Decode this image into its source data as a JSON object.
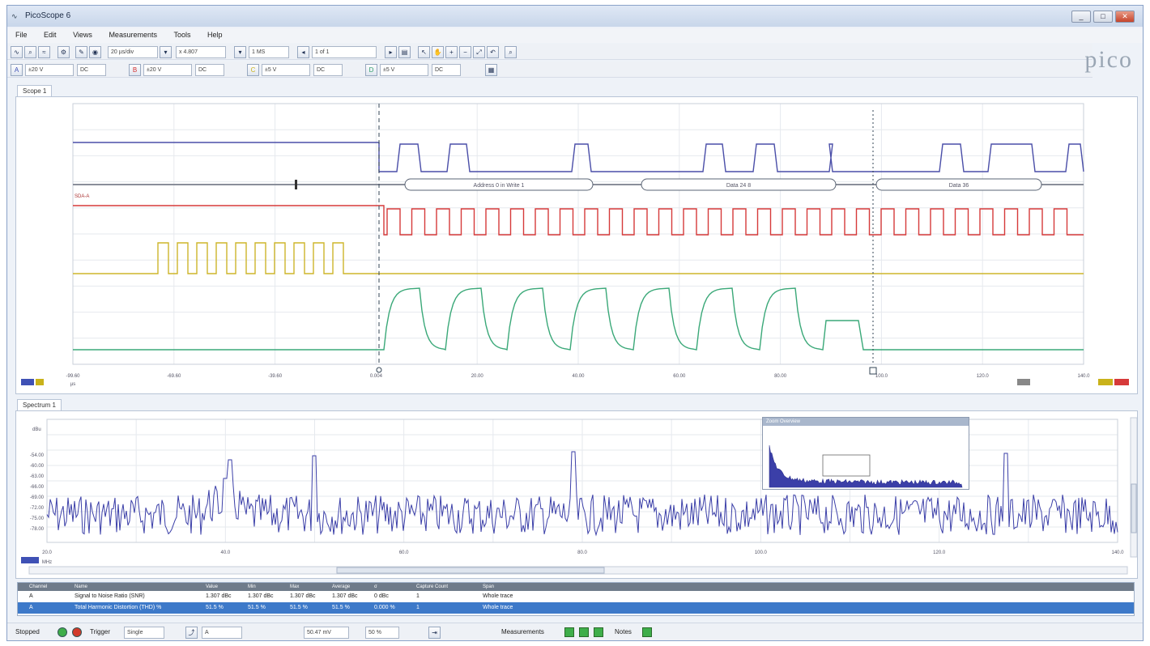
{
  "app": {
    "title": "PicoScope 6",
    "logo": "pico"
  },
  "window_buttons": {
    "minimize": "_",
    "maximize": "□",
    "close": "✕"
  },
  "menu": [
    "File",
    "Edit",
    "Views",
    "Measurements",
    "Tools",
    "Help"
  ],
  "toolbar": {
    "timebase": "20 µs/div",
    "samples": "x 4.807",
    "zoom": "1 MS",
    "capture": "1 of 1"
  },
  "channels": [
    {
      "name": "A",
      "range": "±20 V",
      "color": "#3f51b5"
    },
    {
      "name": "B",
      "range": "±20 V",
      "color": "#d32f2f"
    },
    {
      "name": "C",
      "range": "±5 V",
      "color": "#c9b21a"
    },
    {
      "name": "D",
      "range": "±5 V",
      "color": "#2e9e6a"
    }
  ],
  "scope": {
    "tab": "Scope 1",
    "x_ticks": [
      "-99.60",
      "-69.60",
      "-39.60",
      "0.004",
      "20.00",
      "40.00",
      "60.00",
      "80.00",
      "100.0",
      "120.0",
      "140.0"
    ],
    "x_unit": "µs",
    "bus_labels": [
      "Address 0 in Write 1",
      "Data 24 8",
      "Data 36"
    ],
    "decode_label": "SDA-A",
    "colors": {
      "a": "#4a4ea8",
      "b": "#d63a3a",
      "c": "#cdb52a",
      "d": "#3aa878",
      "bus": "#8a8e9a"
    }
  },
  "spectrum": {
    "tab": "Spectrum 1",
    "y_unit": "dBu",
    "x_unit": "MHz",
    "y_ticks": [
      "-54.00",
      "-60.00",
      "-63.00",
      "-66.00",
      "-69.00",
      "-72.00",
      "-75.00",
      "-78.00"
    ],
    "x_ticks": [
      "20.0",
      "40.0",
      "60.0",
      "80.0",
      "100.0",
      "120.0",
      "140.0"
    ],
    "inset_title": "Zoom Overview",
    "color": "#3b3fa8"
  },
  "measurements": {
    "headers": [
      "Channel",
      "Name",
      "Value",
      "Min",
      "Max",
      "Average",
      "σ",
      "Capture Count",
      "Span"
    ],
    "rows": [
      {
        "channel": "A",
        "name": "Signal to Noise Ratio (SNR)",
        "value": "1.307 dBc",
        "min": "1.307 dBc",
        "max": "1.307 dBc",
        "average": "1.307 dBc",
        "sigma": "0 dBc",
        "count": "1",
        "span": "Whole trace"
      },
      {
        "channel": "A",
        "name": "Total Harmonic Distortion (THD) %",
        "value": "51.5 %",
        "min": "51.5 %",
        "max": "51.5 %",
        "average": "51.5 %",
        "sigma": "0.000 %",
        "count": "1",
        "span": "Whole trace"
      }
    ]
  },
  "status": {
    "state": "Stopped",
    "trigger_label": "Trigger",
    "trigger_mode": "Single",
    "trigger_channel": "A",
    "threshold": "50.47 mV",
    "pretrigger": "50 %",
    "measurements_label": "Measurements",
    "notes_label": "Notes"
  }
}
